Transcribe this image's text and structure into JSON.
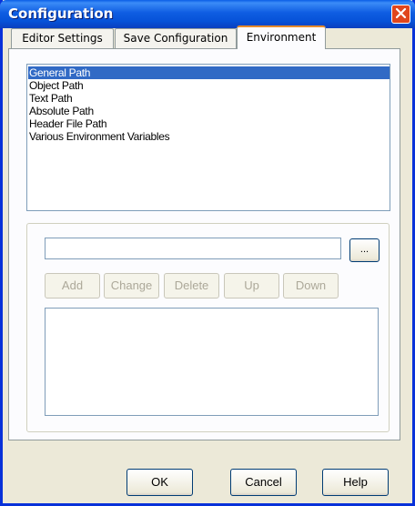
{
  "window": {
    "title": "Configuration"
  },
  "tabs": [
    {
      "label": "Editor Settings",
      "active": false
    },
    {
      "label": "Save Configuration",
      "active": false
    },
    {
      "label": "Environment",
      "active": true
    }
  ],
  "path_list": {
    "items": [
      {
        "label": "General Path",
        "selected": true
      },
      {
        "label": "Object Path",
        "selected": false
      },
      {
        "label": "Text Path",
        "selected": false
      },
      {
        "label": "Absolute Path",
        "selected": false
      },
      {
        "label": "Header File Path",
        "selected": false
      },
      {
        "label": "Various Environment Variables",
        "selected": false
      }
    ]
  },
  "path_editor": {
    "input_value": "",
    "browse_label": "...",
    "buttons": [
      {
        "label": "Add",
        "enabled": false
      },
      {
        "label": "Change",
        "enabled": false
      },
      {
        "label": "Delete",
        "enabled": false
      },
      {
        "label": "Up",
        "enabled": false
      },
      {
        "label": "Down",
        "enabled": false
      }
    ],
    "entries": []
  },
  "footer": {
    "ok_label": "OK",
    "cancel_label": "Cancel",
    "help_label": "Help"
  },
  "colors": {
    "title_bar": "#0a5ee6",
    "selection": "#316ac5",
    "close_button": "#e0461d",
    "active_tab_highlight": "#e68b2c"
  },
  "icons": {
    "close": "close-icon"
  }
}
